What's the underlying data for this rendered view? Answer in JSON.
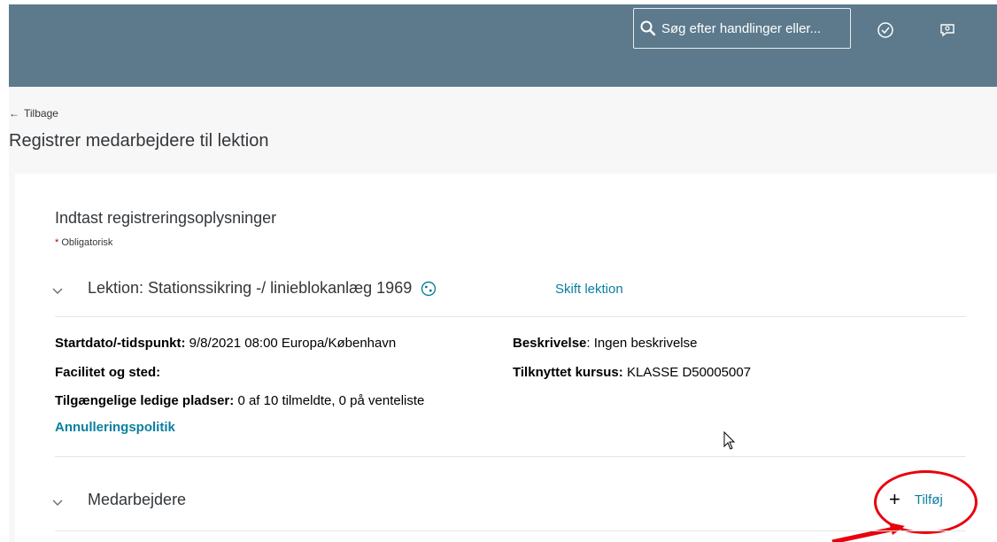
{
  "colors": {
    "topbar": "#5c7a8c",
    "link": "#0a7fa0",
    "annotation": "#e8000d",
    "required": "#bb0000"
  },
  "header": {
    "search_placeholder": "Søg efter handlinger eller...",
    "icons": [
      "search-icon",
      "check-circle-icon",
      "feedback-chat-icon"
    ]
  },
  "nav": {
    "back_label": "Tilbage"
  },
  "page": {
    "title": "Registrer medarbejdere til lektion"
  },
  "form": {
    "heading": "Indtast registreringsoplysninger",
    "required_star": "*",
    "required_label": "Obligatorisk",
    "lesson": {
      "title": "Lektion: Stationssikring -/ linieblokanlæg 1969",
      "change_link": "Skift lektion",
      "start_label": "Startdato/-tidspunkt:",
      "start_value": "9/8/2021 08:00 Europa/København",
      "facility_label": "Facilitet og sted:",
      "seats_label": "Tilgængelige ledige pladser:",
      "seats_value": "0 af 10 tilmeldte, 0 på venteliste",
      "description_label": "Beskrivelse",
      "description_value": ": Ingen beskrivelse",
      "course_label": "Tilknyttet kursus:",
      "course_value": "KLASSE D50005007",
      "cancel_policy": "Annulleringspolitik"
    },
    "employees": {
      "title": "Medarbejdere",
      "add_icon": "+",
      "add_label": "Tilføj"
    }
  }
}
